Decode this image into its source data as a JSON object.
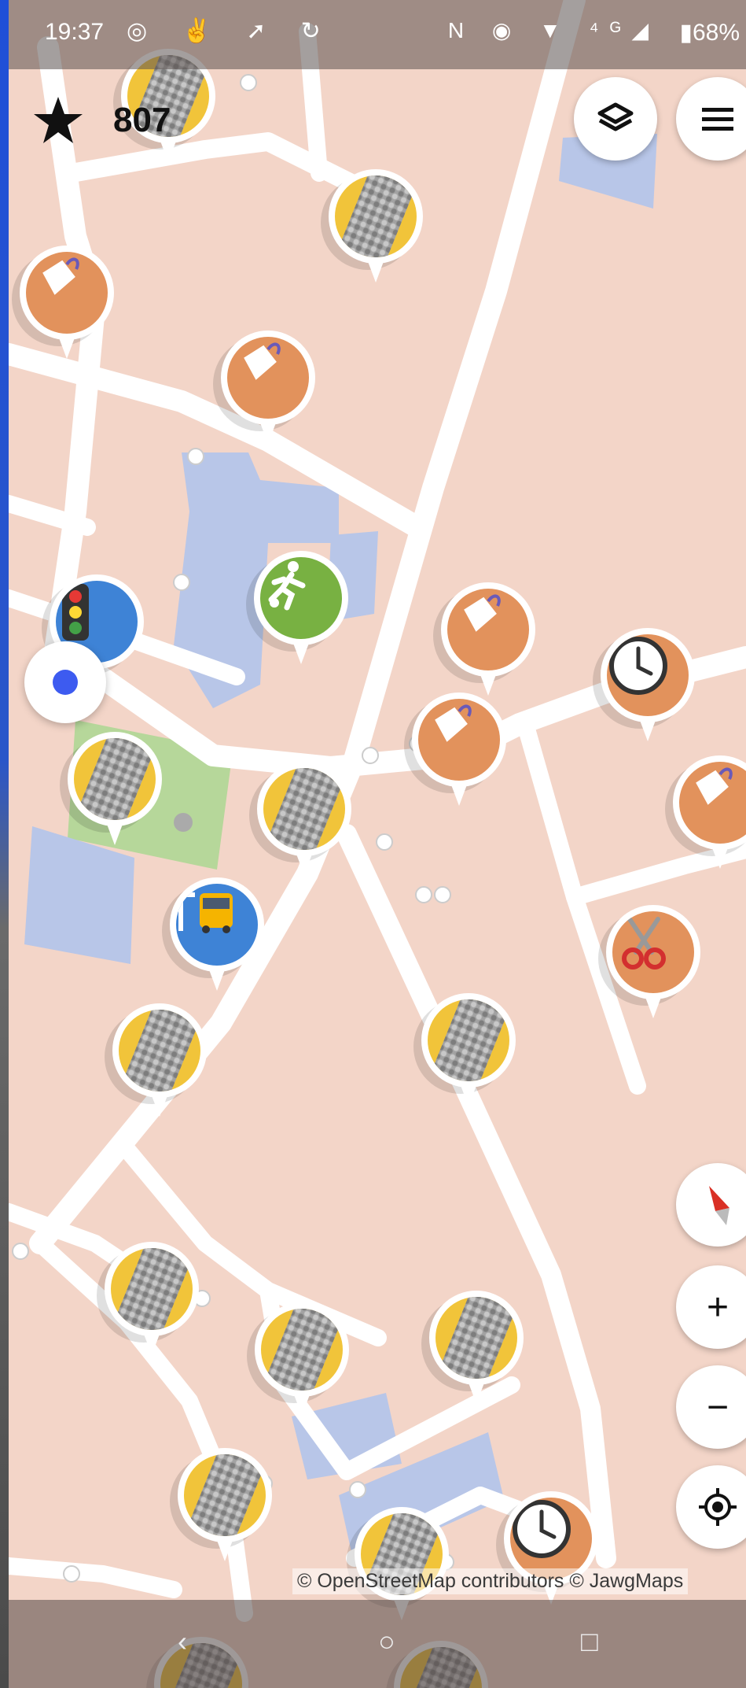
{
  "status_bar": {
    "time": "19:37",
    "left_icons": "◎ ✌ ➚ ↻",
    "right_icons": "N ◉ ▼ ⁴ᴳ◢",
    "battery": "▮68%"
  },
  "stars": {
    "count": "807",
    "icon": "star-icon"
  },
  "buttons": {
    "layers": "layers-icon",
    "menu": "menu-icon",
    "compass": "compass-icon",
    "zoom_in": "+",
    "zoom_out": "−",
    "locate": "locate-icon"
  },
  "attribution": "© OpenStreetMap contributors  © JawgMaps",
  "nav_bar": {
    "back": "‹",
    "home": "○",
    "recents": "□"
  },
  "pins": [
    {
      "type": "cobble"
    },
    {
      "type": "cobble"
    },
    {
      "type": "tag"
    },
    {
      "type": "tag"
    },
    {
      "type": "traffic-light"
    },
    {
      "type": "sports"
    },
    {
      "type": "tag"
    },
    {
      "type": "clock"
    },
    {
      "type": "tag"
    },
    {
      "type": "tag"
    },
    {
      "type": "cobble"
    },
    {
      "type": "cobble"
    },
    {
      "type": "bus"
    },
    {
      "type": "scissors"
    },
    {
      "type": "cobble"
    },
    {
      "type": "cobble"
    },
    {
      "type": "cobble"
    },
    {
      "type": "cobble"
    },
    {
      "type": "cobble"
    },
    {
      "type": "cobble"
    },
    {
      "type": "cobble"
    },
    {
      "type": "clock"
    }
  ],
  "colors": {
    "map_background": "#f3d5c8",
    "road": "#ffffff",
    "building": "#b8c6e8",
    "park": "#b6d79a",
    "pin_orange": "#e2925c",
    "pin_blue": "#3e83d6",
    "pin_green": "#78b142",
    "cobble_yellow": "#f1c43a",
    "position_dot": "#3d5bf0"
  }
}
